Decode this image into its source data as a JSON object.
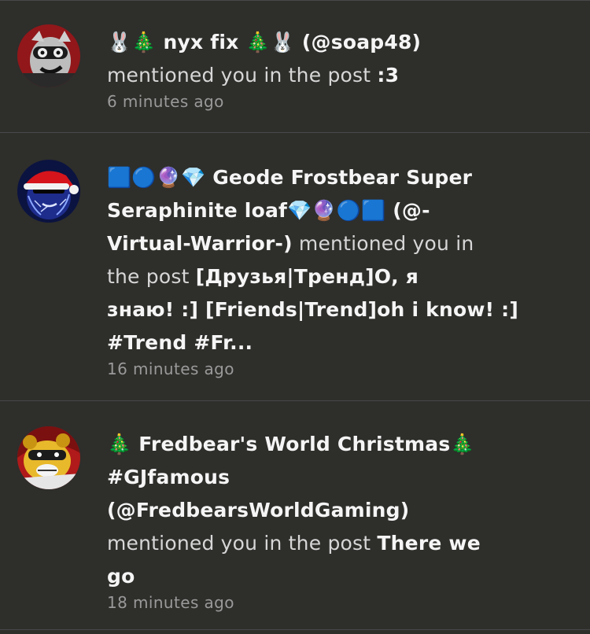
{
  "notifications": [
    {
      "lines": [
        [
          {
            "t": "🐰🎄 nyx fix 🎄🐰  (@soap48)",
            "s": "b"
          }
        ],
        [
          {
            "t": "mentioned you in the post ",
            "s": "n"
          },
          {
            "t": ":3",
            "s": "b"
          }
        ]
      ],
      "time": "6 minutes ago",
      "avatar_icon": "masked-face-avatar"
    },
    {
      "lines": [
        [
          {
            "t": "🟦🔵🔮💎 Geode Frostbear Super",
            "s": "b"
          }
        ],
        [
          {
            "t": "Seraphinite loaf💎🔮🔵🟦  (@-",
            "s": "b"
          }
        ],
        [
          {
            "t": "Virtual-Warrior-)",
            "s": "b"
          },
          {
            "t": " mentioned you in",
            "s": "n"
          }
        ],
        [
          {
            "t": "the post ",
            "s": "n"
          },
          {
            "t": "[Друзья|Тренд]О, я",
            "s": "b"
          }
        ],
        [
          {
            "t": "знаю! :] [Friends|Trend]oh i know! :]",
            "s": "b"
          }
        ],
        [
          {
            "t": "#Trend #Fr...",
            "s": "b"
          }
        ]
      ],
      "time": "16 minutes ago",
      "avatar_icon": "santa-hat-avatar"
    },
    {
      "lines": [
        [
          {
            "t": "🎄 Fredbear's World Christmas🎄",
            "s": "b"
          }
        ],
        [
          {
            "t": "#GJfamous",
            "s": "b"
          }
        ],
        [
          {
            "t": "(@FredbearsWorldGaming)",
            "s": "b"
          }
        ],
        [
          {
            "t": "mentioned you in the post ",
            "s": "n"
          },
          {
            "t": "There we",
            "s": "b"
          }
        ],
        [
          {
            "t": "go",
            "s": "b"
          }
        ]
      ],
      "time": "18 minutes ago",
      "avatar_icon": "yellow-bear-avatar"
    }
  ]
}
